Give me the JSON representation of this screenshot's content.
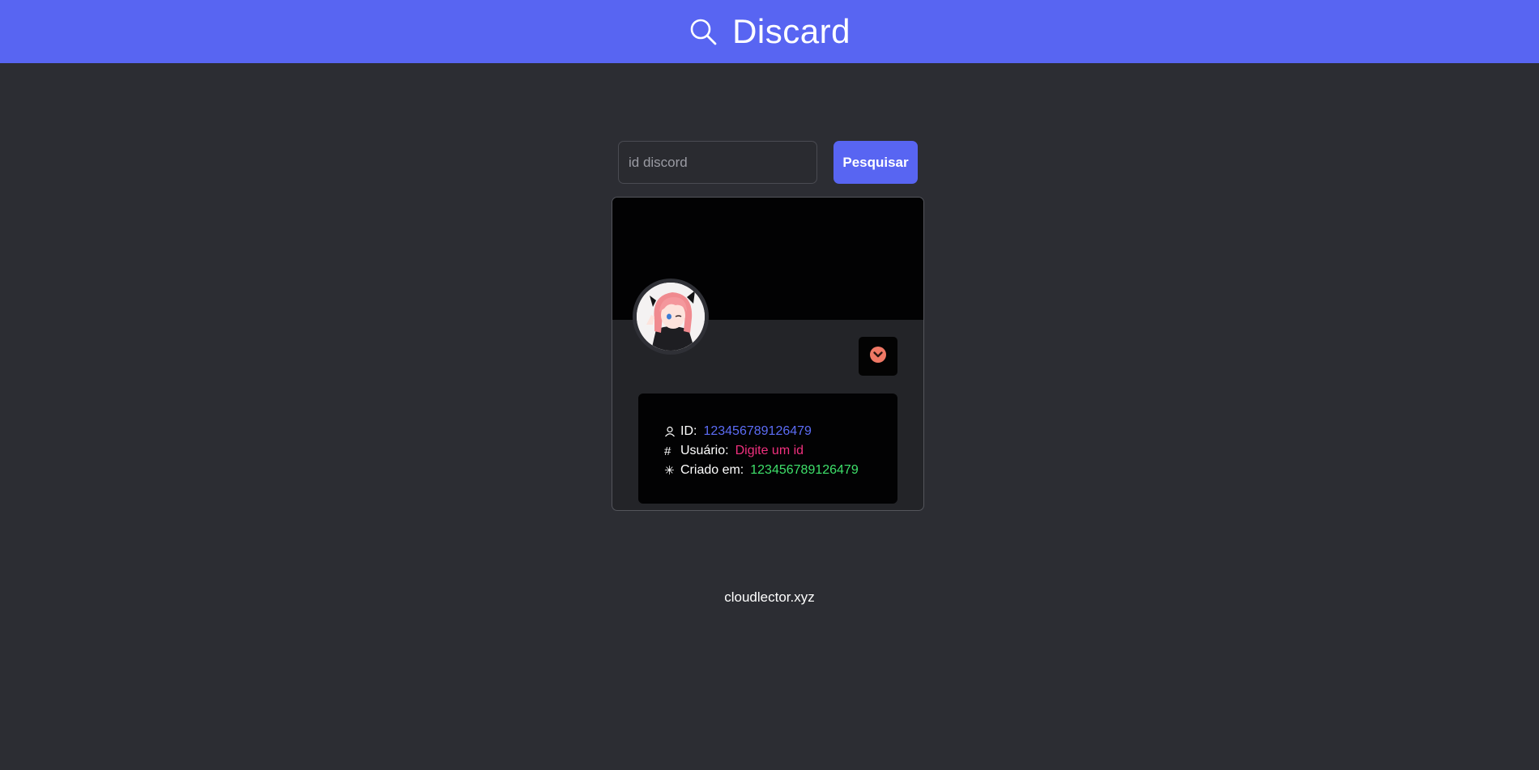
{
  "header": {
    "title": "Discard",
    "icon": "search-icon",
    "background": "#5865f2"
  },
  "search": {
    "placeholder": "id discord",
    "value": "",
    "button_label": "Pesquisar"
  },
  "profile": {
    "avatar": "avatar-image",
    "badge_icon": "chevron-down-circle-icon",
    "badge_color": "#f07865",
    "rows": [
      {
        "icon": "user-icon",
        "label": "ID:",
        "value": "123456789126479",
        "color": "#5c6cf5"
      },
      {
        "icon": "hash-icon",
        "label": "Usuário:",
        "value": "Digite um id",
        "color": "#f0307e"
      },
      {
        "icon": "asterisk-icon",
        "label": "Criado em:",
        "value": "123456789126479",
        "color": "#3ee06a"
      }
    ]
  },
  "footer": {
    "text": "cloudlector.xyz"
  }
}
